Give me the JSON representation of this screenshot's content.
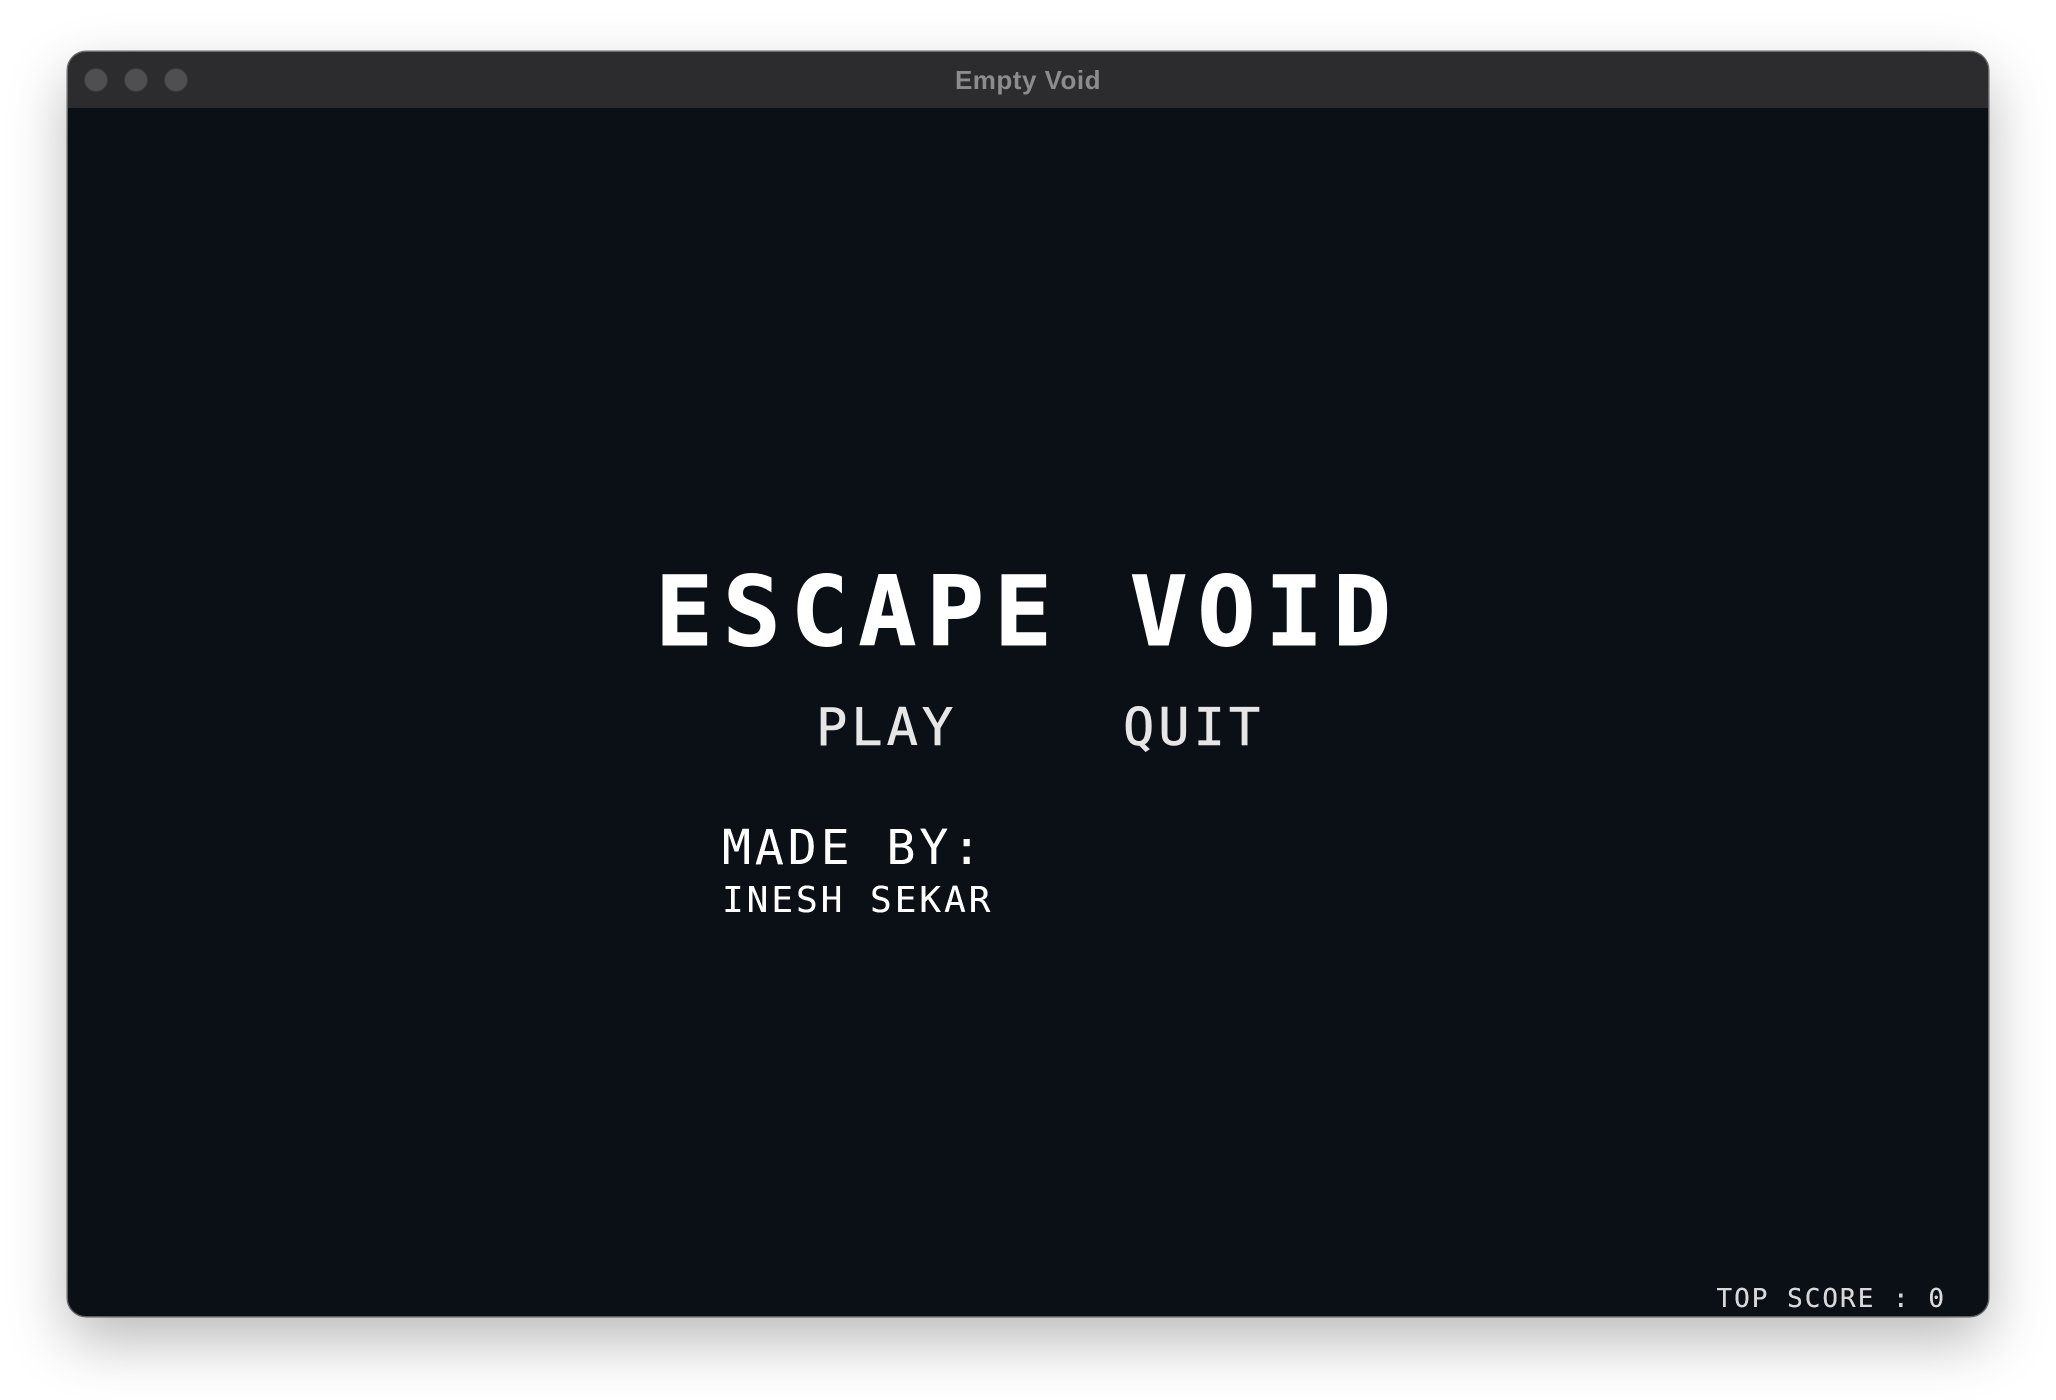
{
  "window": {
    "title": "Empty Void"
  },
  "game": {
    "title": "ESCAPE VOID",
    "menu": {
      "play_label": "PLAY",
      "quit_label": "QUIT"
    },
    "credits": {
      "label": "MADE BY:",
      "name": "INESH SEKAR"
    },
    "top_score": {
      "label": "TOP SCORE",
      "separator": " : ",
      "value": "0"
    }
  },
  "colors": {
    "background": "#0b0f16",
    "text": "#ffffff",
    "titlebar": "#2c2c2e"
  }
}
